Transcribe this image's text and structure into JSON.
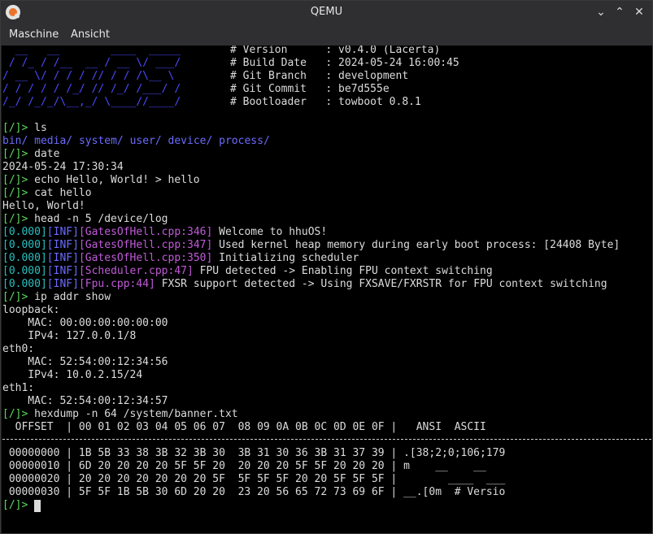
{
  "window": {
    "title": "QEMU",
    "app_icon": "qemu-icon",
    "controls": [
      "chevron-down-icon",
      "chevron-up-icon",
      "close-icon"
    ]
  },
  "menu": [
    "Maschine",
    "Ansicht"
  ],
  "banner": {
    "logo_lines": [
      "  __   __        ____  _____ ",
      " / /_ / /__  __ / __ \\/ ___/ ",
      "/ __ \\/ / / / // / / /\\__ \\  ",
      "/ / / / / /_/ // /_/ /___/ /  ",
      "/_/ /_/_/\\__,_/ \\____//____/  "
    ],
    "info": [
      "# Version      : v0.4.0 (Lacerta)",
      "# Build Date   : 2024-05-24 16:00:45",
      "# Git Branch   : development",
      "# Git Commit   : be7d555e",
      "# Bootloader   : towboot 0.8.1"
    ]
  },
  "prompt": "[/]>",
  "session": {
    "cmd_ls": "ls",
    "ls_output": [
      "bin/",
      "media/",
      "system/",
      "user/",
      "device/",
      "process/"
    ],
    "cmd_date": "date",
    "date_output": "2024-05-24 17:30:34",
    "cmd_echo": "echo Hello, World! > hello",
    "cmd_cat": "cat hello",
    "cat_output": "Hello, World!",
    "cmd_head": "head -n 5 /device/log",
    "log": [
      {
        "time": "[0.000]",
        "level": "[INF]",
        "source": "[GatesOfHell.cpp:346]",
        "message": "Welcome to hhuOS!"
      },
      {
        "time": "[0.000]",
        "level": "[INF]",
        "source": "[GatesOfHell.cpp:347]",
        "message": "Used kernel heap memory during early boot process: [24408 Byte]"
      },
      {
        "time": "[0.000]",
        "level": "[INF]",
        "source": "[GatesOfHell.cpp:350]",
        "message": "Initializing scheduler"
      },
      {
        "time": "[0.000]",
        "level": "[INF]",
        "source": "[Scheduler.cpp:47]",
        "message": "FPU detected -> Enabling FPU context switching"
      },
      {
        "time": "[0.000]",
        "level": "[INF]",
        "source": "[Fpu.cpp:44]",
        "message": "FXSR support detected -> Using FXSAVE/FXRSTR for FPU context switching"
      }
    ],
    "cmd_ip": "ip addr show",
    "ip_output": [
      "loopback:",
      "    MAC: 00:00:00:00:00:00",
      "    IPv4: 127.0.0.1/8",
      "eth0:",
      "    MAC: 52:54:00:12:34:56",
      "    IPv4: 10.0.2.15/24",
      "eth1:",
      "    MAC: 52:54:00:12:34:57"
    ],
    "cmd_hexdump": "hexdump -n 64 /system/banner.txt",
    "hexdump_header": "  OFFSET  | 00 01 02 03 04 05 06 07  08 09 0A 0B 0C 0D 0E 0F |   ANSI  ASCII",
    "hexdump_rows": [
      " 00000000 | 1B 5B 33 38 3B 32 3B 30  3B 31 30 36 3B 31 37 39 | .[38;2;0;106;179",
      " 00000010 | 6D 20 20 20 20 5F 5F 20  20 20 20 5F 5F 20 20 20 | m    __    __   ",
      " 00000020 | 20 20 20 20 20 20 20 5F  5F 5F 5F 20 20 5F 5F 5F |        ____  ___",
      " 00000030 | 5F 5F 1B 5B 30 6D 20 20  23 20 56 65 72 73 69 6F | __.[0m  # Versio"
    ]
  }
}
